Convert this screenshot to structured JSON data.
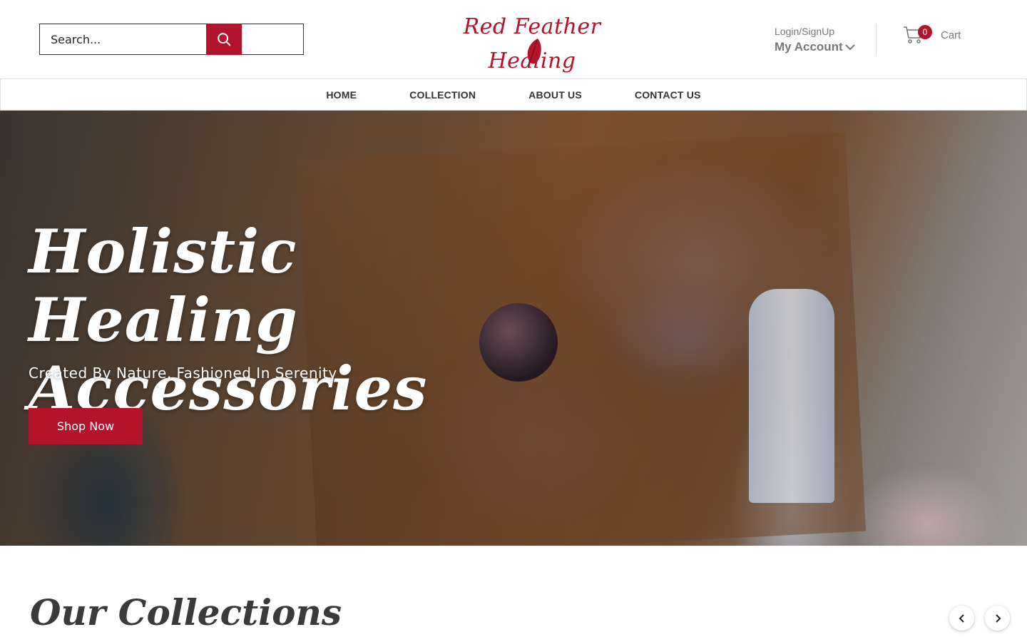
{
  "header": {
    "search": {
      "placeholder": "Search..."
    },
    "logo_text": "Red Feather Healing",
    "account": {
      "login_label": "Login/SignUp",
      "my_account_label": "My Account"
    },
    "cart": {
      "count": "0",
      "label": "Cart"
    }
  },
  "nav": {
    "items": [
      {
        "label": "HOME"
      },
      {
        "label": "COLLECTION"
      },
      {
        "label": "ABOUT US"
      },
      {
        "label": "CONTACT US"
      }
    ]
  },
  "hero": {
    "title_line1": "Holistic Healing",
    "title_line2": "Accessories",
    "subtitle": "Created By Nature, Fashioned In Serenity",
    "cta_label": "Shop Now"
  },
  "collections": {
    "title": "Our Collections"
  },
  "colors": {
    "brand_red": "#b3132b",
    "text_gray": "#777777",
    "dark_text": "#333333"
  },
  "icons": [
    "search-icon",
    "feather-icon",
    "chevron-down-icon",
    "cart-icon",
    "chevron-left-icon",
    "chevron-right-icon"
  ]
}
